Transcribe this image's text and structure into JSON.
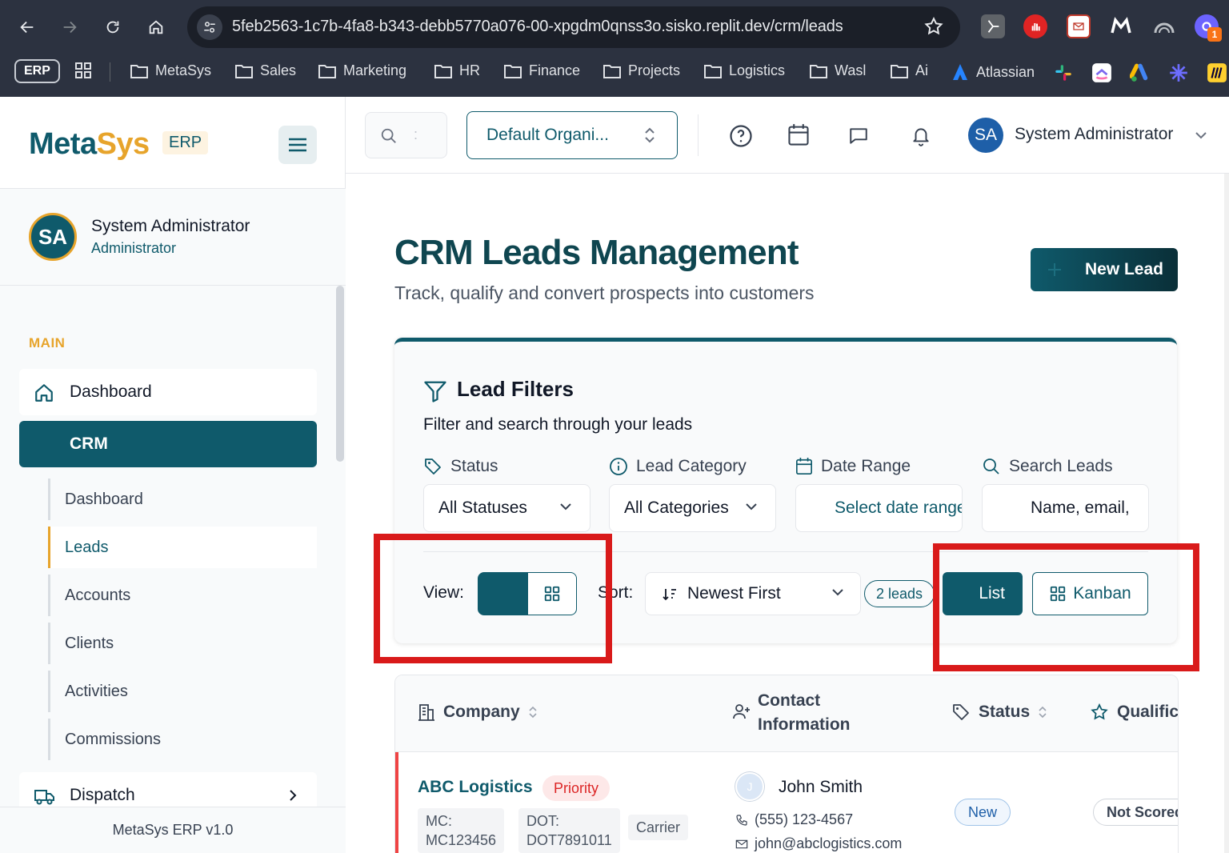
{
  "browser": {
    "url": "5feb2563-1c7b-4fa8-b343-debb5770a076-00-xpgdm0qnss3o.sisko.replit.dev/crm/leads",
    "ext_badge": "1",
    "bookmarks": {
      "chip": "ERP",
      "items": [
        "MetaSys",
        "Sales",
        "Marketing",
        "HR",
        "Finance",
        "Projects",
        "Logistics",
        "Wasl",
        "Ai",
        "Atlassian"
      ]
    }
  },
  "sidebar": {
    "logo_meta": "Meta",
    "logo_sys": "Sys",
    "logo_badge": "ERP",
    "user": {
      "initials": "SA",
      "name": "System Administrator",
      "role": "Administrator"
    },
    "section": "MAIN",
    "items": [
      {
        "label": "Dashboard"
      },
      {
        "label": "CRM"
      },
      {
        "label": "Dispatch"
      }
    ],
    "crm_sub": [
      "Dashboard",
      "Leads",
      "Accounts",
      "Clients",
      "Activities",
      "Commissions"
    ],
    "footer": "MetaSys ERP v1.0"
  },
  "topbar": {
    "search_hint": ":",
    "org": "Default Organi...",
    "user_initials": "SA",
    "user_name": "System Administrator"
  },
  "page": {
    "title": "CRM Leads Management",
    "subtitle": "Track, qualify and convert prospects into customers",
    "new_lead": "New Lead"
  },
  "filters": {
    "title": "Lead Filters",
    "subtitle": "Filter and search through your leads",
    "status_label": "Status",
    "status_value": "All Statuses",
    "category_label": "Lead Category",
    "category_value": "All Categories",
    "date_label": "Date Range",
    "date_placeholder": "Select date range",
    "search_label": "Search Leads",
    "search_placeholder": "Name, email,",
    "view_label": "View:",
    "sort_label": "Sort:",
    "sort_value": "Newest First",
    "count": "2 leads",
    "list_btn": "List",
    "kanban_btn": "Kanban"
  },
  "table": {
    "headers": {
      "company": "Company",
      "contact_1": "Contact",
      "contact_2": "Information",
      "status": "Status",
      "qualification": "Qualific"
    },
    "rows": [
      {
        "company": "ABC Logistics",
        "badge": "Priority",
        "mc_label": "MC:",
        "mc": "MC123456",
        "dot_label": "DOT:",
        "dot": "DOT7891011",
        "type": "Carrier",
        "contact_initial": "J",
        "contact_name": "John Smith",
        "phone": "(555) 123-4567",
        "email": "john@abclogistics.com",
        "status": "New",
        "score": "Not Scored"
      }
    ]
  },
  "colors": {
    "primary": "#0f5a6b",
    "accent": "#e7a42b",
    "highlight": "#d91a1a",
    "chrome": "#2c3240"
  }
}
